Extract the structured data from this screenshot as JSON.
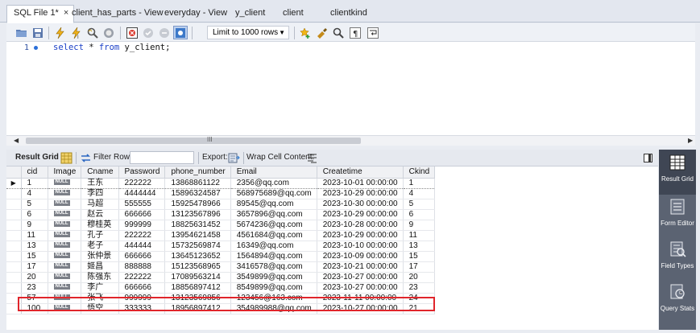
{
  "tabs": [
    {
      "label": "SQL File 1*",
      "active": true,
      "closable": true
    },
    {
      "label": "client_has_parts - View"
    },
    {
      "label": "everyday - View"
    },
    {
      "label": "y_client"
    },
    {
      "label": "client"
    },
    {
      "label": "clientkind"
    }
  ],
  "toolbar": {
    "limit_select": "Limit to 1000 rows"
  },
  "editor": {
    "line_number": "1",
    "keyword_select": "select",
    "star": "*",
    "keyword_from": "from",
    "rest": "y_client;"
  },
  "scroll_grip": "III",
  "result_bar": {
    "title": "Result Grid",
    "filter_label": "Filter Rows:",
    "filter_value": "",
    "export_label": "Export:",
    "wrap_label": "Wrap Cell Content:"
  },
  "grid": {
    "columns": [
      "cid",
      "Image",
      "Cname",
      "Password",
      "phone_number",
      "Email",
      "Createtime",
      "Ckind"
    ],
    "null_label": "NULL",
    "rows": [
      {
        "cid": "1",
        "cname": "王东",
        "password": "222222",
        "phone": "13868861122",
        "email": "2356@qq.com",
        "createtime": "2023-10-01 00:00:00",
        "ckind": "1"
      },
      {
        "cid": "4",
        "cname": "李四",
        "password": "4444444",
        "phone": "15896324587",
        "email": "568975689@qq.com",
        "createtime": "2023-10-29 00:00:00",
        "ckind": "4"
      },
      {
        "cid": "5",
        "cname": "马超",
        "password": "555555",
        "phone": "15925478966",
        "email": "89545@qq.com",
        "createtime": "2023-10-30 00:00:00",
        "ckind": "5"
      },
      {
        "cid": "6",
        "cname": "赵云",
        "password": "666666",
        "phone": "13123567896",
        "email": "3657896@qq.com",
        "createtime": "2023-10-29 00:00:00",
        "ckind": "6"
      },
      {
        "cid": "9",
        "cname": "穆桂英",
        "password": "999999",
        "phone": "18825631452",
        "email": "5674236@qq.com",
        "createtime": "2023-10-28 00:00:00",
        "ckind": "9"
      },
      {
        "cid": "11",
        "cname": "孔子",
        "password": "222222",
        "phone": "13954621458",
        "email": "4561684@qq.com",
        "createtime": "2023-10-29 00:00:00",
        "ckind": "11"
      },
      {
        "cid": "13",
        "cname": "老子",
        "password": "444444",
        "phone": "15732569874",
        "email": "16349@qq.com",
        "createtime": "2023-10-10 00:00:00",
        "ckind": "13"
      },
      {
        "cid": "15",
        "cname": "张仲景",
        "password": "666666",
        "phone": "13645123652",
        "email": "1564894@qq.com",
        "createtime": "2023-10-09 00:00:00",
        "ckind": "15"
      },
      {
        "cid": "17",
        "cname": "姬昌",
        "password": "888888",
        "phone": "15123568965",
        "email": "3416578@qq.com",
        "createtime": "2023-10-21 00:00:00",
        "ckind": "17"
      },
      {
        "cid": "20",
        "cname": "陈强东",
        "password": "222222",
        "phone": "17089563214",
        "email": "3549899@qq.com",
        "createtime": "2023-10-27 00:00:00",
        "ckind": "20"
      },
      {
        "cid": "23",
        "cname": "李广",
        "password": "666666",
        "phone": "18856897412",
        "email": "8549899@qq.com",
        "createtime": "2023-10-27 00:00:00",
        "ckind": "23"
      },
      {
        "cid": "57",
        "cname": "张飞",
        "password": "999999",
        "phone": "13123569856",
        "email": "123456@163.com",
        "createtime": "2023-11-11 00:00:00",
        "ckind": "24"
      },
      {
        "cid": "100",
        "cname": "悟空",
        "password": "333333",
        "phone": "18956897412",
        "email": "354989988@qq.com",
        "createtime": "2023-10-27 00:00:00",
        "ckind": "21"
      }
    ]
  },
  "side_panel": [
    {
      "label": "Result Grid",
      "icon": "result-grid-icon",
      "active": true
    },
    {
      "label": "Form Editor",
      "icon": "form-editor-icon"
    },
    {
      "label": "Field Types",
      "icon": "field-types-icon"
    },
    {
      "label": "Query Stats",
      "icon": "query-stats-icon"
    }
  ],
  "colors": {
    "highlight_box": "#e0252b",
    "side_panel": "#5b6372",
    "keyword": "#1a3fc7"
  }
}
